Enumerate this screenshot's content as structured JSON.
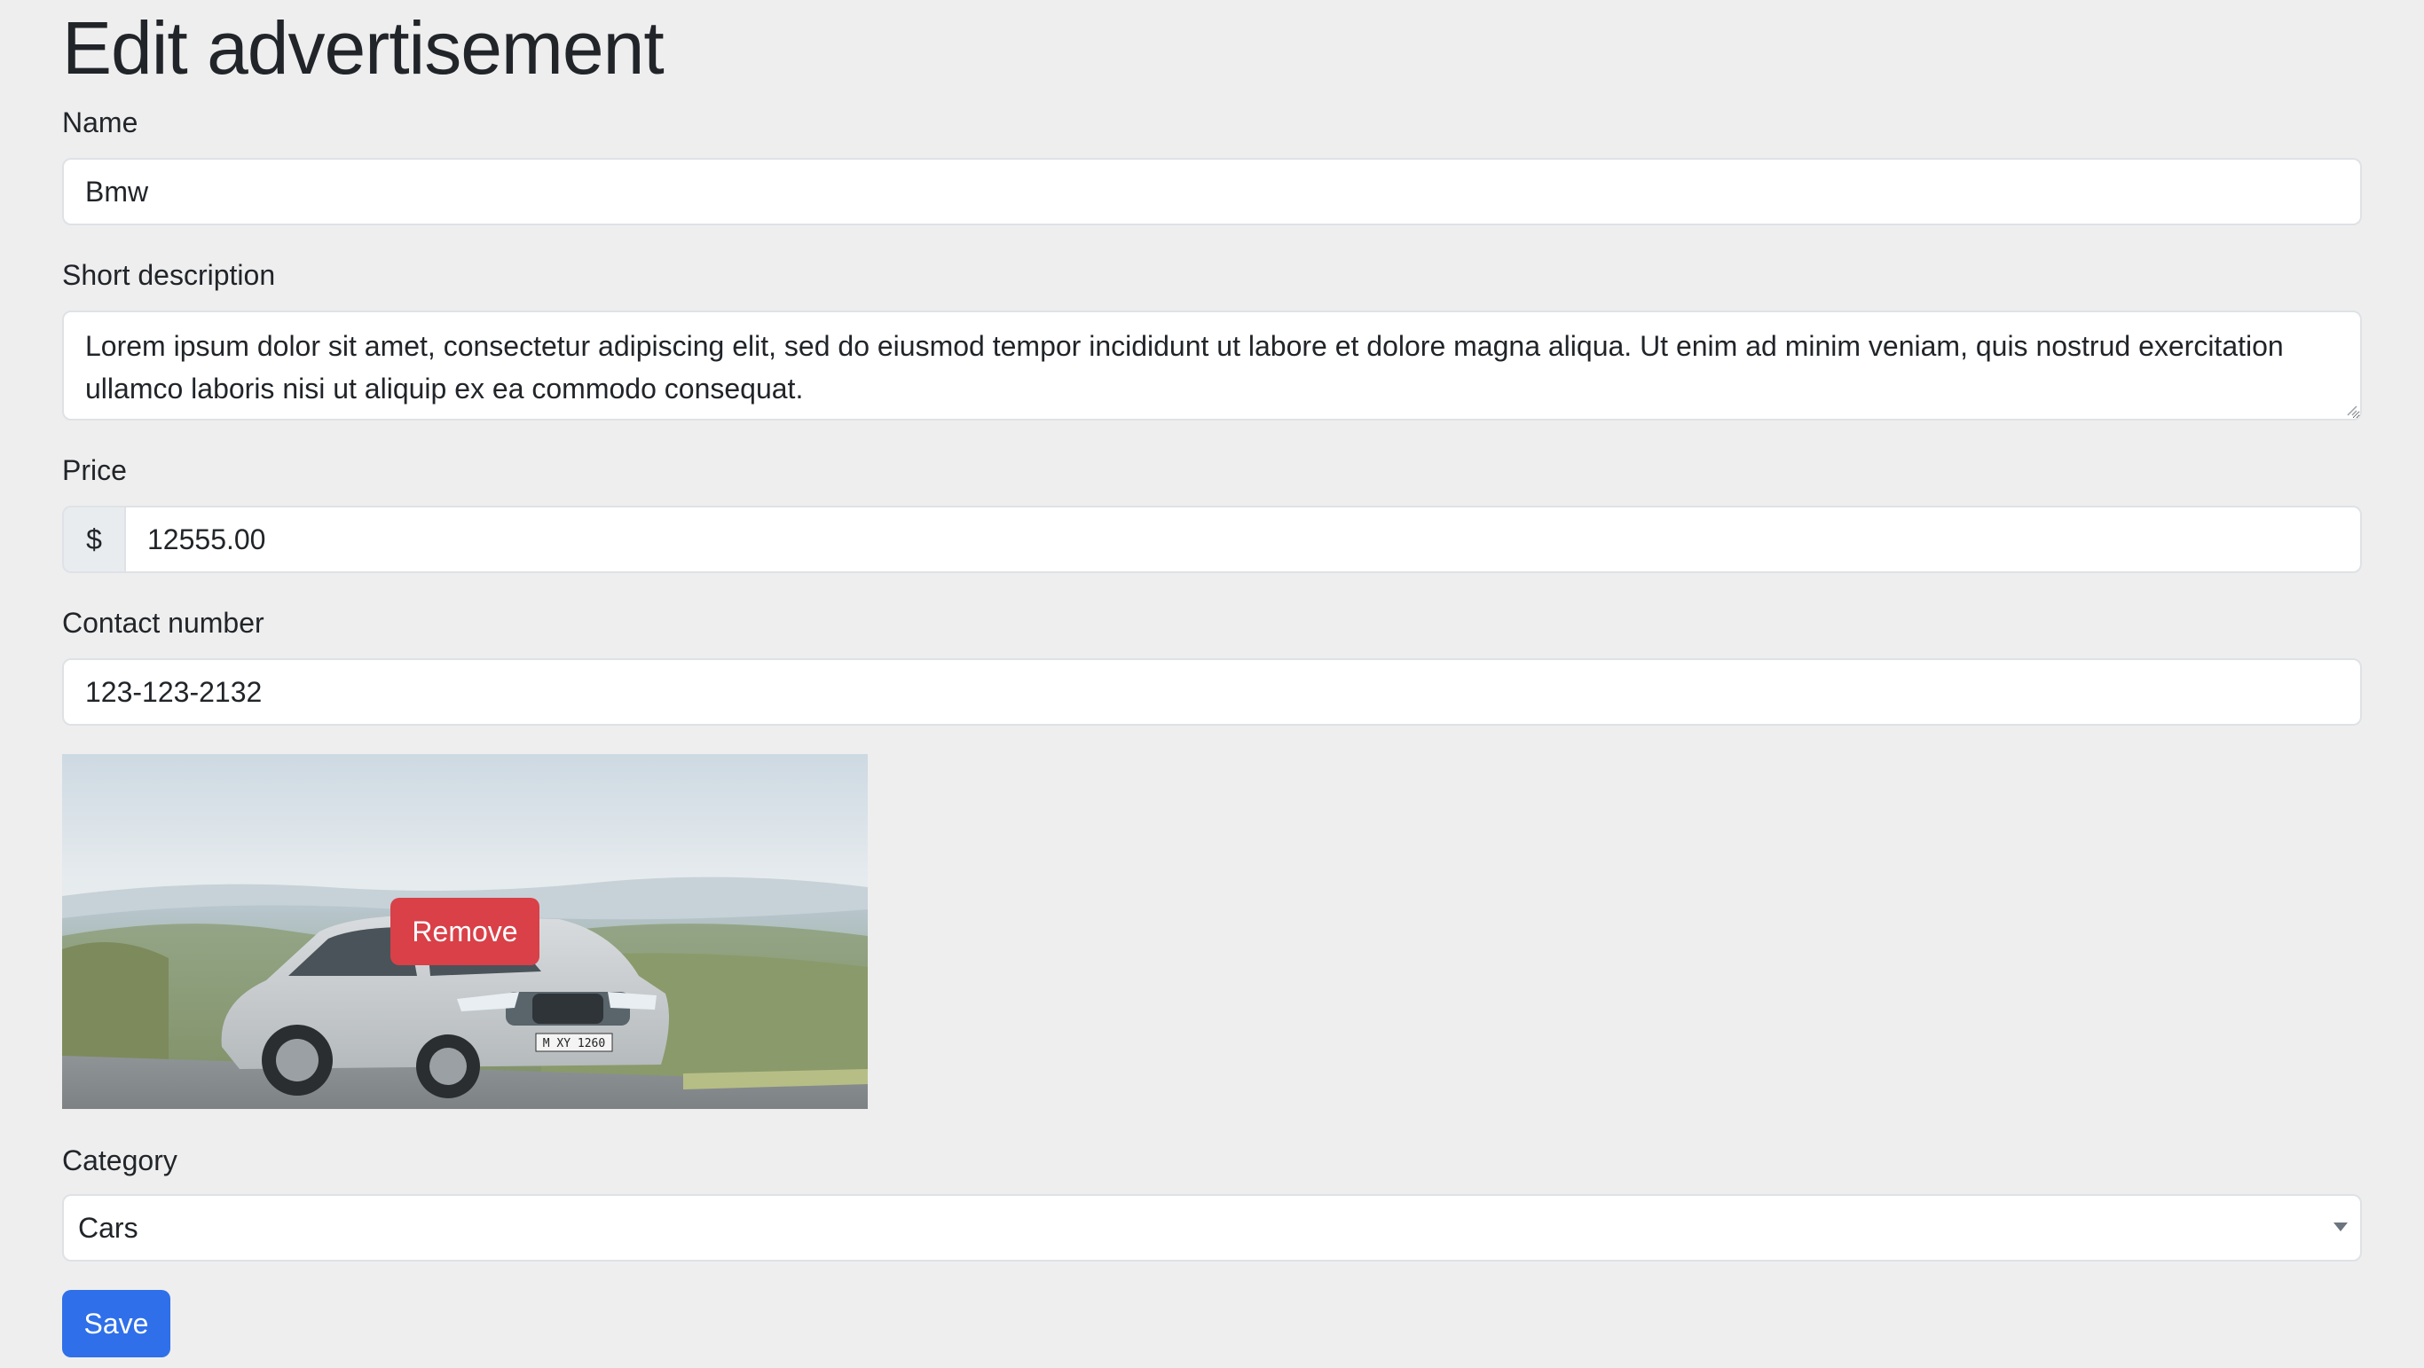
{
  "page": {
    "title": "Edit advertisement"
  },
  "form": {
    "name": {
      "label": "Name",
      "value": "Bmw"
    },
    "short_description": {
      "label": "Short description",
      "value": "Lorem ipsum dolor sit amet, consectetur adipiscing elit, sed do eiusmod tempor incididunt ut labore et dolore magna aliqua. Ut enim ad minim veniam, quis nostrud exercitation ullamco laboris nisi ut aliquip ex ea commodo consequat."
    },
    "price": {
      "label": "Price",
      "currency_symbol": "$",
      "value": "12555.00"
    },
    "contact_number": {
      "label": "Contact number",
      "value": "123-123-2132"
    },
    "image": {
      "remove_label": "Remove",
      "plate_text": "M XY 1260"
    },
    "category": {
      "label": "Category",
      "selected": "Cars"
    },
    "save_label": "Save"
  },
  "colors": {
    "page_background": "#eeeeee",
    "save_button": "#2f6fe9",
    "remove_button": "#d94048",
    "input_border": "#dee2e6"
  }
}
